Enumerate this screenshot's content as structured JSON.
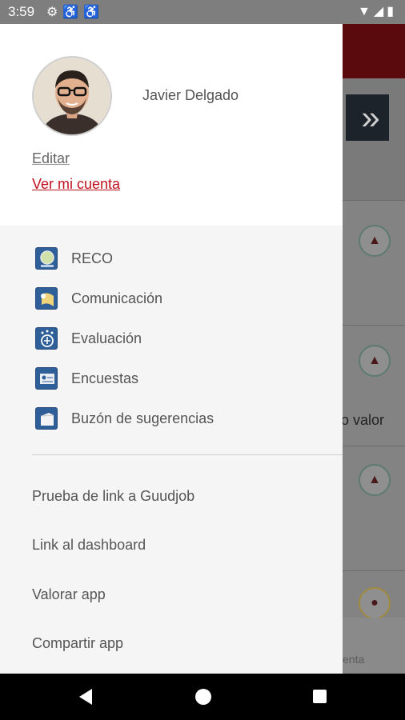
{
  "status_bar": {
    "time": "3:59",
    "left_icons": [
      "gear-icon",
      "accessibility-icon",
      "accessibility-icon"
    ],
    "right_icons": [
      "wifi-icon",
      "signal-icon",
      "battery-icon"
    ]
  },
  "profile": {
    "name": "Javier Delgado",
    "edit_label": "Editar",
    "account_label": "Ver mi cuenta"
  },
  "menu": {
    "items": [
      {
        "label": "RECO",
        "icon": "reco-icon"
      },
      {
        "label": "Comunicación",
        "icon": "comunicacion-icon"
      },
      {
        "label": "Evaluación",
        "icon": "evaluacion-icon"
      },
      {
        "label": "Encuestas",
        "icon": "encuestas-icon"
      },
      {
        "label": "Buzón de sugerencias",
        "icon": "buzon-icon"
      }
    ]
  },
  "links": [
    {
      "label": "Prueba de link a Guudjob"
    },
    {
      "label": "Link al dashboard"
    },
    {
      "label": "Valorar app"
    },
    {
      "label": "Compartir app"
    }
  ],
  "background": {
    "partial_text": "o valor",
    "bottom_label": "enta"
  },
  "colors": {
    "accent": "#c0121e",
    "drawer_bg": "#f5f5f5",
    "icon_blue": "#2f5f98"
  }
}
